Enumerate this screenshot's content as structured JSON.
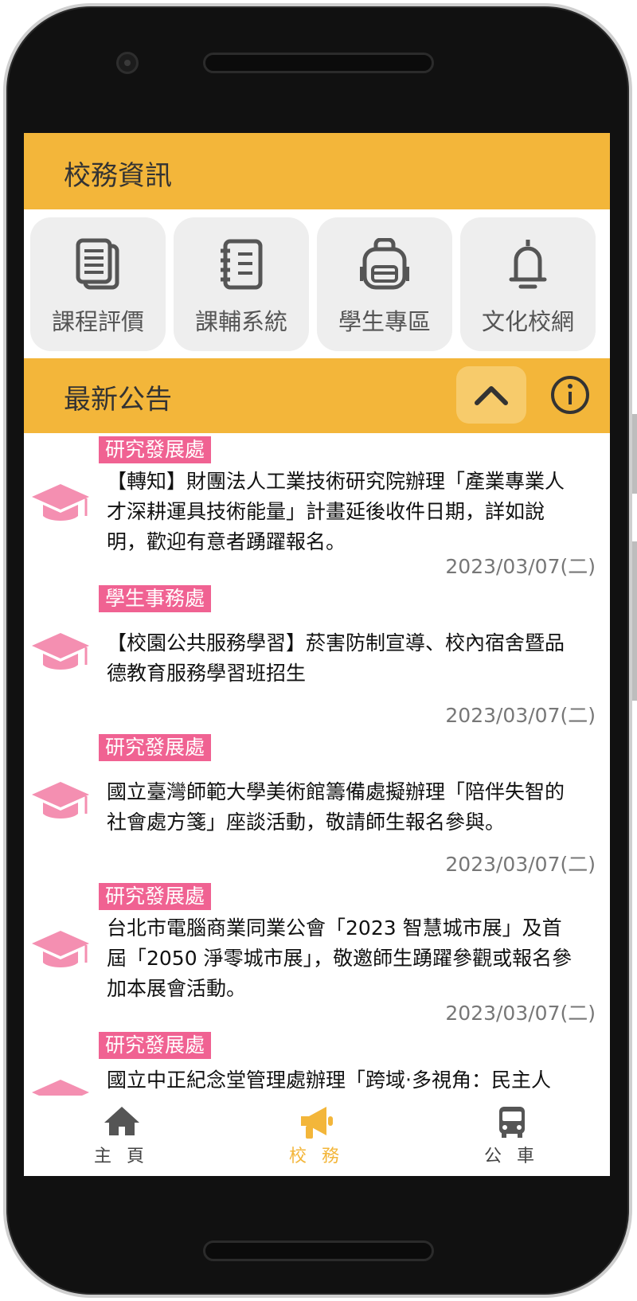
{
  "header": {
    "title": "校務資訊"
  },
  "quick_links": [
    {
      "label": "課程評價",
      "icon": "document-stack-icon"
    },
    {
      "label": "課輔系統",
      "icon": "notebook-icon"
    },
    {
      "label": "學生專區",
      "icon": "backpack-icon"
    },
    {
      "label": "文化校網",
      "icon": "bell-icon"
    }
  ],
  "announcements_bar": {
    "title": "最新公告",
    "collapse_icon": "chevron-up-icon",
    "info_icon": "info-icon"
  },
  "news": [
    {
      "dept": "研究發展處",
      "text": "【轉知】財團法人工業技術研究院辦理「產業專業人才深耕運具技術能量」計畫延後收件日期，詳如說明，歡迎有意者踴躍報名。",
      "date": "2023/03/07(二)"
    },
    {
      "dept": "學生事務處",
      "text": "【校園公共服務學習】菸害防制宣導、校內宿舍暨品德教育服務學習班招生",
      "date": "2023/03/07(二)"
    },
    {
      "dept": "研究發展處",
      "text": "國立臺灣師範大學美術館籌備處擬辦理「陪伴失智的社會處方箋」座談活動，敬請師生報名參與。",
      "date": "2023/03/07(二)"
    },
    {
      "dept": "研究發展處",
      "text": "台北市電腦商業同業公會「2023 智慧城市展」及首屆「2050 淨零城市展」，敬邀師生踴躍參觀或報名參加本展會活動。",
      "date": "2023/03/07(二)"
    },
    {
      "dept": "研究發展處",
      "text": "國立中正紀念堂管理處辦理「跨域‧多視角：民主人",
      "date": ""
    }
  ],
  "bottom_nav": [
    {
      "label": "主 頁",
      "icon": "home-icon"
    },
    {
      "label": "校 務",
      "icon": "megaphone-icon"
    },
    {
      "label": "公 車",
      "icon": "bus-icon"
    }
  ],
  "colors": {
    "accent": "#f3b63a",
    "tag": "#f06292",
    "icon_pink": "#f48fb1"
  }
}
